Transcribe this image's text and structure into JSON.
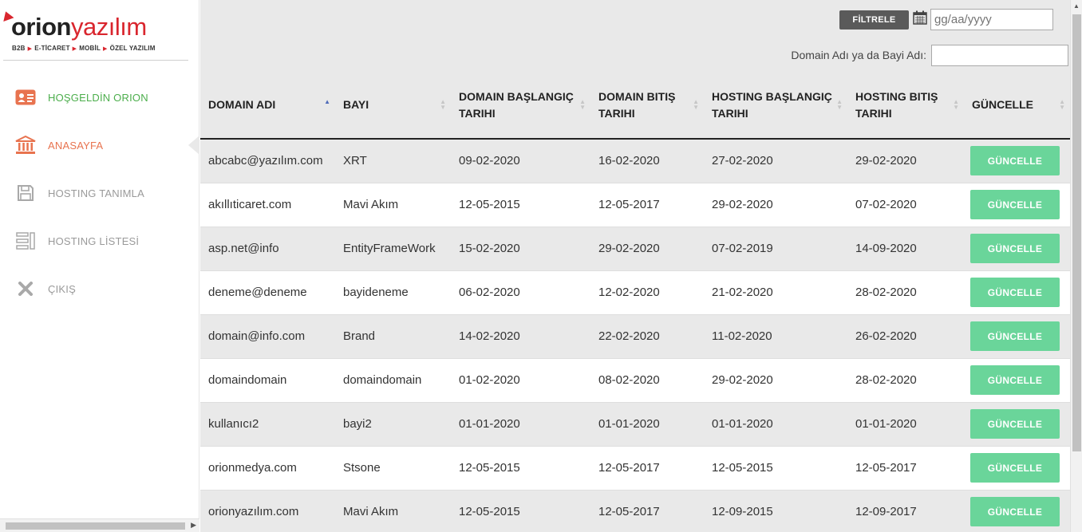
{
  "brand": {
    "name_part1": "orion",
    "name_part2": "yazılım",
    "tagline": [
      "B2B",
      "E-TİCARET",
      "MOBİL",
      "ÖZEL YAZILIM"
    ],
    "colors": {
      "red": "#d9262e",
      "dark": "#222222"
    }
  },
  "sidebar": {
    "items": [
      {
        "label": "HOŞGELDİN ORION",
        "icon": "id-card-icon",
        "color": "#4cae4c"
      },
      {
        "label": "ANASAYFA",
        "icon": "bank-icon",
        "color": "#e8734f",
        "active": true
      },
      {
        "label": "HOSTING TANIMLA",
        "icon": "floppy-disk-icon",
        "color": "#9a9a9a"
      },
      {
        "label": "HOSTING LİSTESİ",
        "icon": "list-icon",
        "color": "#9a9a9a"
      },
      {
        "label": "ÇIKIŞ",
        "icon": "close-icon",
        "color": "#9a9a9a"
      }
    ]
  },
  "toolbar": {
    "filter_label": "FİLTRELE",
    "date_placeholder": "gg/aa/yyyy",
    "search_label": "Domain Adı ya da Bayi Adı:",
    "search_value": ""
  },
  "table": {
    "columns": [
      "DOMAIN ADI",
      "BAYI",
      "DOMAIN BAŞLANGIÇ TARIHI",
      "DOMAIN BITIŞ TARIHI",
      "HOSTING BAŞLANGIÇ TARIHI",
      "HOSTING BITIŞ TARIHI",
      "GÜNCELLE"
    ],
    "sorted_column": "DOMAIN ADI",
    "update_label": "GÜNCELLE",
    "rows": [
      [
        "abcabc@yazılım.com",
        "XRT",
        "09-02-2020",
        "16-02-2020",
        "27-02-2020",
        "29-02-2020"
      ],
      [
        "akıllıticaret.com",
        "Mavi Akım",
        "12-05-2015",
        "12-05-2017",
        "29-02-2020",
        "07-02-2020"
      ],
      [
        "asp.net@info",
        "EntityFrameWork",
        "15-02-2020",
        "29-02-2020",
        "07-02-2019",
        "14-09-2020"
      ],
      [
        "deneme@deneme",
        "bayideneme",
        "06-02-2020",
        "12-02-2020",
        "21-02-2020",
        "28-02-2020"
      ],
      [
        "domain@info.com",
        "Brand",
        "14-02-2020",
        "22-02-2020",
        "11-02-2020",
        "26-02-2020"
      ],
      [
        "domaindomain",
        "domaindomain",
        "01-02-2020",
        "08-02-2020",
        "29-02-2020",
        "28-02-2020"
      ],
      [
        "kullanıcı2",
        "bayi2",
        "01-01-2020",
        "01-01-2020",
        "01-01-2020",
        "01-01-2020"
      ],
      [
        "orionmedya.com",
        "Stsone",
        "12-05-2015",
        "12-05-2017",
        "12-05-2015",
        "12-05-2017"
      ],
      [
        "orionyazılım.com",
        "Mavi Akım",
        "12-05-2015",
        "12-05-2017",
        "12-09-2015",
        "12-09-2017"
      ]
    ]
  },
  "colors": {
    "update_button": "#6ad59a",
    "filter_button": "#5a5a5a",
    "row_alt": "#e9e9e9",
    "sort_active": "#4f6bb9"
  }
}
